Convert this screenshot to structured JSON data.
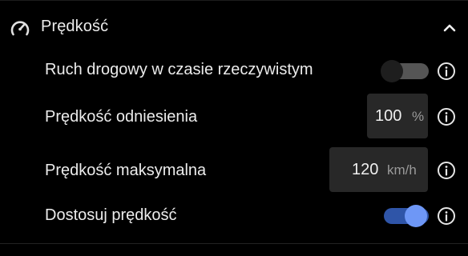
{
  "section": {
    "title": "Prędkość",
    "icon": "speedometer-icon",
    "collapse_icon": "chevron-up-icon"
  },
  "rows": [
    {
      "label": "Ruch drogowy w czasie rzeczywistym",
      "control": "toggle",
      "state": "off"
    },
    {
      "label": "Prędkość odniesienia",
      "control": "number",
      "value": "100",
      "unit": "%"
    },
    {
      "label": "Prędkość maksymalna",
      "control": "number",
      "value": "120",
      "unit": "km/h"
    },
    {
      "label": "Dostosuj prędkość",
      "control": "toggle",
      "state": "on"
    }
  ],
  "colors": {
    "background": "#000000",
    "text": "#ececec",
    "field_bg": "#282828",
    "toggle_on_track": "#2f55a8",
    "toggle_on_knob": "#6e97f6",
    "toggle_off_track": "#555555"
  }
}
